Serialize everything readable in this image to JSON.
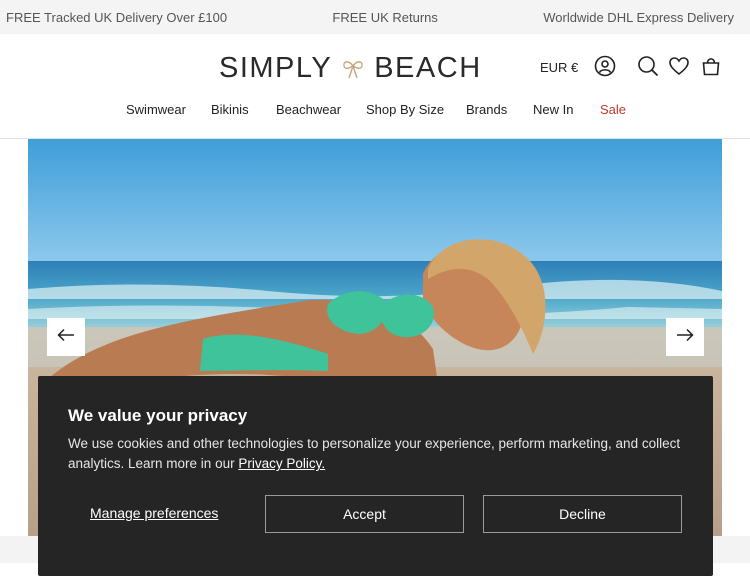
{
  "announcement_bar": {
    "messages": [
      "FREE Tracked UK Delivery Over £100",
      "FREE UK Returns",
      "Worldwide DHL Express Delivery"
    ]
  },
  "header": {
    "logo_left": "SIMPLY",
    "logo_right": "BEACH",
    "currency": "EUR €",
    "icons": [
      "account-icon",
      "search-icon",
      "wishlist-heart-icon",
      "shopping-bag-icon"
    ]
  },
  "nav": {
    "items": [
      "Swimwear",
      "Bikinis",
      "Beachwear",
      "Shop By Size",
      "Brands",
      "New In",
      "Sale"
    ],
    "sale_color": "#c0392b"
  },
  "hero": {
    "prev_icon": "arrow-left-icon",
    "next_icon": "arrow-right-icon"
  },
  "cookie_banner": {
    "title": "We value your privacy",
    "description": "We use cookies and other technologies to personalize your experience, perform marketing, and collect analytics. Learn more in our ",
    "policy_link": "Privacy Policy.",
    "manage_label": "Manage preferences",
    "accept_label": "Accept",
    "decline_label": "Decline",
    "background_color": "#252525"
  }
}
